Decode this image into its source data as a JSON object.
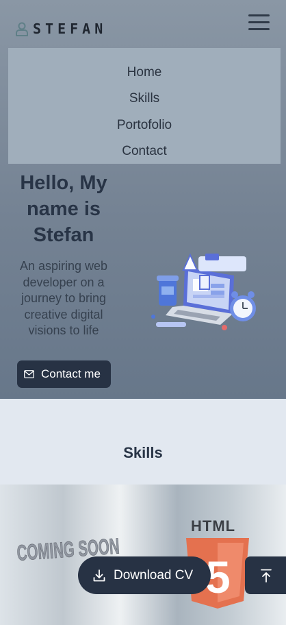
{
  "header": {
    "brand_name": "STEFAN",
    "logo_icon": "user-outline-icon",
    "menu_icon": "hamburger-icon"
  },
  "nav": {
    "items": [
      {
        "label": "Home"
      },
      {
        "label": "Skills"
      },
      {
        "label": "Portofolio"
      },
      {
        "label": "Contact"
      }
    ]
  },
  "hero": {
    "heading": "Hello, My name is Stefan",
    "tagline": "An aspiring web developer on a journey to bring creative digital visions to life",
    "contact_label": "Contact me",
    "contact_icon": "envelope-icon",
    "illustration_icon": "laptop-workspace-illustration"
  },
  "skills": {
    "title": "Skills",
    "cards": [
      {
        "text": "COMING SOON"
      },
      {
        "text": "HTML",
        "badge": "5"
      }
    ]
  },
  "floating": {
    "download_label": "Download CV",
    "download_icon": "download-icon",
    "top_icon": "arrow-up-to-top-icon"
  },
  "colors": {
    "accent_dark": "#273244",
    "hero_bg": "#7a8898",
    "menu_bg": "#a0aebb",
    "section_bg": "#e2e8f0",
    "html_orange": "#e4714f"
  }
}
